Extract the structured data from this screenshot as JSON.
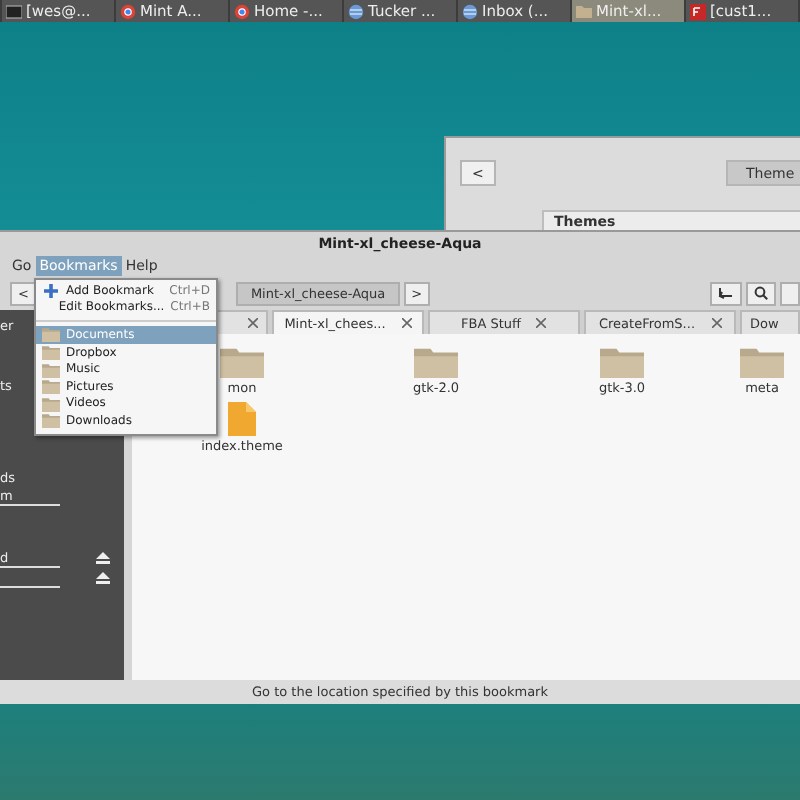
{
  "taskbar": {
    "items": [
      {
        "label": "[wes@...",
        "kind": "terminal",
        "selected": false
      },
      {
        "label": "Mint A...",
        "kind": "browser",
        "selected": false
      },
      {
        "label": "Home -...",
        "kind": "browser",
        "selected": false
      },
      {
        "label": "Tucker ...",
        "kind": "globe",
        "selected": false
      },
      {
        "label": "Inbox (...",
        "kind": "globe",
        "selected": false
      },
      {
        "label": "Mint-xl...",
        "kind": "folder",
        "selected": true
      },
      {
        "label": "[cust1...",
        "kind": "ftp",
        "selected": false
      }
    ]
  },
  "back_window": {
    "back_button": "<",
    "path_button": "Theme",
    "header": "Themes"
  },
  "window": {
    "title": "Mint-xl_cheese-Aqua",
    "menu": [
      {
        "label": "Go",
        "selected": false
      },
      {
        "label": "Bookmarks",
        "selected": true
      },
      {
        "label": "Help",
        "selected": false
      }
    ],
    "toolbar": {
      "back_button": "<",
      "path_button": "Mint-xl_cheese-Aqua",
      "next_button": ">"
    },
    "tabs": [
      {
        "selected": false
      },
      {
        "label": "Mint-xl_chees...",
        "selected": true
      },
      {
        "label": "FBA Stuff",
        "selected": false
      },
      {
        "label": "CreateFromS...",
        "selected": false
      },
      {
        "label": "Dow",
        "selected": false
      }
    ],
    "sidebar": {
      "items": [
        {
          "label": "er",
          "usage": false
        },
        {
          "label": "ts",
          "usage": false
        },
        {
          "label": "ds",
          "eject": false,
          "usage": false
        },
        {
          "label": "m",
          "eject": false,
          "usage": true
        },
        {
          "label": "d",
          "eject": true,
          "usage": true
        },
        {
          "eject": true,
          "usage": true
        }
      ]
    },
    "files": [
      {
        "name": "mon",
        "kind": "folder"
      },
      {
        "name": "gtk-2.0",
        "kind": "folder"
      },
      {
        "name": "gtk-3.0",
        "kind": "folder"
      },
      {
        "name": "meta",
        "kind": "folder"
      },
      {
        "name": "index.theme",
        "kind": "file"
      }
    ],
    "status_bar": "Go to the location specified by this bookmark"
  },
  "bookmarks_menu": {
    "items": [
      {
        "kind": "action",
        "label": "Add Bookmark",
        "shortcut": "Ctrl+D",
        "icon": true,
        "selected": false
      },
      {
        "kind": "action",
        "label": "Edit Bookmarks...",
        "shortcut": "Ctrl+B",
        "icon": false,
        "selected": false
      },
      {
        "kind": "separator"
      },
      {
        "kind": "place",
        "label": "Documents",
        "selected": true
      },
      {
        "kind": "place",
        "label": "Dropbox",
        "selected": false
      },
      {
        "kind": "place",
        "label": "Music",
        "selected": false
      },
      {
        "kind": "place",
        "label": "Pictures",
        "selected": false
      },
      {
        "kind": "place",
        "label": "Videos",
        "selected": false
      },
      {
        "kind": "place",
        "label": "Downloads",
        "selected": false
      }
    ]
  }
}
